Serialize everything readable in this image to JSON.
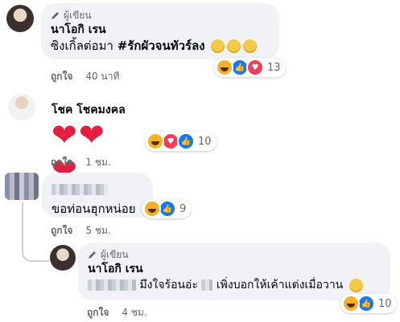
{
  "comments": [
    {
      "author_tag": "ผู้เขียน",
      "name": "นาโอกิ เรน",
      "text": "ซิงเกิ้ลต่อมา ",
      "hashtag": "#รักผัวจนทัวร์ลง",
      "reaction_count": "13",
      "like_label": "ถูกใจ",
      "time": "40 นาที"
    },
    {
      "name": "โชค โชคมงคล",
      "hearts": "❤❤❤",
      "reaction_count": "10",
      "like_label": "ถูกใจ",
      "time": "1 ชม."
    },
    {
      "text": "ขอท่อนฮุกหน่อย",
      "reaction_count": "9",
      "like_label": "ถูกใจ",
      "time": "5 ชม."
    },
    {
      "author_tag": "ผู้เขียน",
      "name": "นาโอกิ เรน",
      "text_part1": "มึงใจร้อนอ่ะ",
      "text_part2": "เพิ่งบอกให้เค้าแต่งเมื่อวาน",
      "reaction_count": "10",
      "like_label": "ถูกใจ",
      "time": "4 ชม."
    }
  ],
  "colors": {
    "bubble": "#f0f2f5",
    "like_blue": "#1877f2",
    "love_red": "#f33e58",
    "haha_yellow": "#f7b125",
    "secondary_text": "#65676b"
  }
}
